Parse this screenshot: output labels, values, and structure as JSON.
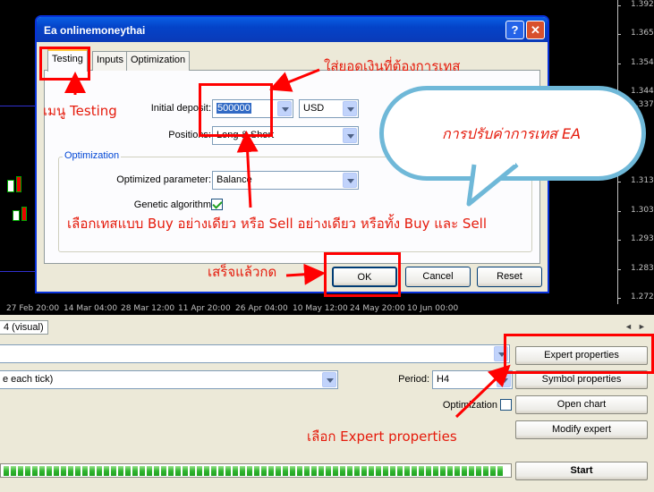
{
  "chart": {
    "prices": [
      "1.39250",
      "1.36500",
      "1.35450",
      "1.34430",
      "1.33730",
      "1.31370",
      "1.30350",
      "1.29330",
      "1.28310",
      "1.27290"
    ],
    "dates": [
      "27 Feb 20:00",
      "14 Mar 04:00",
      "28 Mar 12:00",
      "11 Apr 20:00",
      "26 Apr 04:00",
      "10 May 12:00",
      "24 May 20:00",
      "10 Jun 00:00"
    ]
  },
  "dialog": {
    "title": "Ea onlinemoneythai",
    "help_glyph": "?",
    "close_glyph": "✕",
    "tabs": [
      "Testing",
      "Inputs",
      "Optimization"
    ],
    "initial_deposit_label": "Initial deposit:",
    "initial_deposit_value": "500000",
    "currency_value": "USD",
    "positions_label": "Positions:",
    "positions_value": "Long & Short",
    "optimization_group": "Optimization",
    "optimized_parameter_label": "Optimized parameter:",
    "optimized_parameter_value": "Balance",
    "genetic_label": "Genetic algorithm",
    "genetic_checked": true,
    "ok_label": "OK",
    "cancel_label": "Cancel",
    "reset_label": "Reset"
  },
  "tester": {
    "tab_label": "4 (visual)",
    "model_value": "e each tick)",
    "period_label": "Period:",
    "period_value": "H4",
    "optimization_label": "Optimization",
    "expert_properties": "Expert properties",
    "symbol_properties": "Symbol properties",
    "open_chart": "Open chart",
    "modify_expert": "Modify expert",
    "start": "Start",
    "progress": 1.0
  },
  "annotations": {
    "menu_testing": "เมนู Testing",
    "deposit_note": "ใส่ยอดเงินที่ต้องการเทส",
    "bubble": "การปรับค่าการเทส EA",
    "positions_note": "เลือกเทสแบบ Buy อย่างเดียว หรือ Sell อย่างเดียว หรือทั้ง Buy และ Sell",
    "done_note": "เสร็จแล้วกด",
    "expert_note": "เลือก Expert properties"
  },
  "colors": {
    "annotation": "#e51b0c",
    "titlebar": "#0a5fe4",
    "bubble_border": "#6fb8d8"
  }
}
